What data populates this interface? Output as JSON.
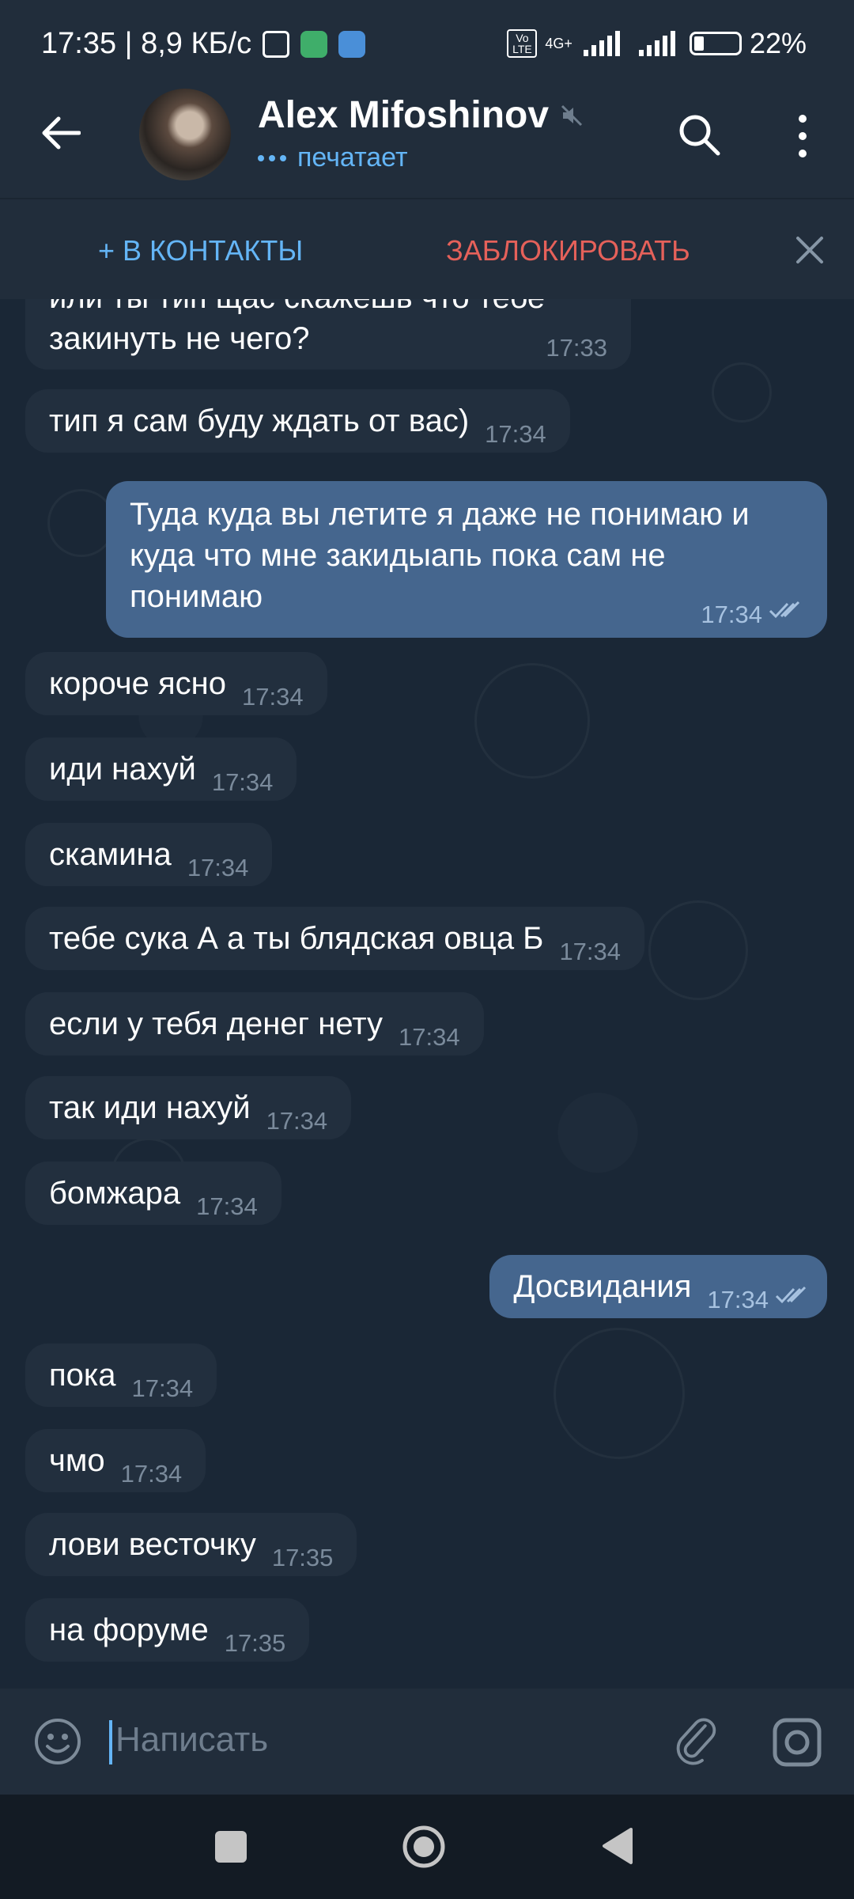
{
  "status_bar": {
    "time_speed": "17:35 | 8,9 КБ/с",
    "network_label": "4G+",
    "volte_label": "Vo LTE",
    "battery": "22%"
  },
  "header": {
    "contact_name": "Alex Mifoshinov",
    "status": "печатает",
    "icons": [
      "back-arrow-icon",
      "mute-icon",
      "search-icon",
      "more-vertical-icon"
    ]
  },
  "actions": {
    "add_contact": "+ В КОНТАКТЫ",
    "block": "ЗАБЛОКИРОВАТЬ"
  },
  "messages": [
    {
      "dir": "in",
      "text": "или ты тип щас скажешь что тебе закинуть не чего?",
      "time": "17:33"
    },
    {
      "dir": "in",
      "text": "тип я сам буду ждать от вас)",
      "time": "17:34"
    },
    {
      "dir": "out",
      "text": "Туда куда вы летите я даже не понимаю и куда что мне закидыапь пока сам не понимаю",
      "time": "17:34",
      "read": true
    },
    {
      "dir": "in",
      "text": "короче ясно",
      "time": "17:34"
    },
    {
      "dir": "in",
      "text": "иди нахуй",
      "time": "17:34"
    },
    {
      "dir": "in",
      "text": "скамина",
      "time": "17:34"
    },
    {
      "dir": "in",
      "text": "тебе сука А а ты блядская овца Б",
      "time": "17:34"
    },
    {
      "dir": "in",
      "text": "если у тебя денег нету",
      "time": "17:34"
    },
    {
      "dir": "in",
      "text": "так иди нахуй",
      "time": "17:34"
    },
    {
      "dir": "in",
      "text": "бомжара",
      "time": "17:34"
    },
    {
      "dir": "out",
      "text": "Досвидания",
      "time": "17:34",
      "read": true
    },
    {
      "dir": "in",
      "text": "пока",
      "time": "17:34"
    },
    {
      "dir": "in",
      "text": "чмо",
      "time": "17:34"
    },
    {
      "dir": "in",
      "text": "лови весточку",
      "time": "17:35"
    },
    {
      "dir": "in",
      "text": "на форуме",
      "time": "17:35"
    }
  ],
  "composer": {
    "placeholder": "Написать"
  },
  "colors": {
    "background": "#1a2736",
    "header": "#212d3b",
    "incoming_bubble": "#222f3e",
    "outgoing_bubble": "#45668e",
    "accent": "#64b5f6",
    "danger": "#e5615a"
  }
}
